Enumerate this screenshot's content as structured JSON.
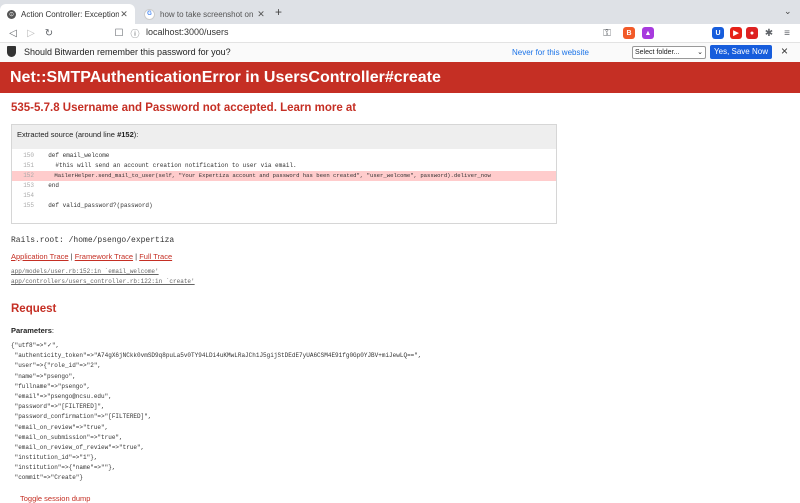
{
  "tabs": [
    {
      "title": "Action Controller: Exception ca",
      "active": true
    },
    {
      "title": "how to take screenshot on mac - G",
      "active": false
    }
  ],
  "new_tab": "+",
  "address": {
    "url": "localhost:3000/users"
  },
  "bitwarden": {
    "prompt": "Should Bitwarden remember this password for you?",
    "never_link": "Never for this website",
    "folder_select": "Select folder...",
    "save_button": "Yes, Save Now",
    "close": "×"
  },
  "error": {
    "title": "Net::SMTPAuthenticationError in UsersController#create",
    "message": "535-5.7.8 Username and Password not accepted. Learn more at"
  },
  "source": {
    "header_prefix": "Extracted source (around line ",
    "header_line": "#152",
    "header_suffix": "):",
    "lines": [
      {
        "n": "150",
        "code": "  def email_welcome"
      },
      {
        "n": "151",
        "code": "    #this will send an account creation notification to user via email."
      },
      {
        "n": "152",
        "code": "    MailerHelper.send_mail_to_user(self, \"Your Expertiza account and password has been created\", \"user_welcome\", password).deliver_now"
      },
      {
        "n": "153",
        "code": "  end"
      },
      {
        "n": "154",
        "code": ""
      },
      {
        "n": "155",
        "code": "  def valid_password?(password)"
      }
    ],
    "highlight_index": 2
  },
  "rails_root": "Rails.root: /home/psengo/expertiza",
  "traces": {
    "app": "Application Trace",
    "framework": "Framework Trace",
    "full": "Full Trace",
    "sep": "|"
  },
  "trace_lines": [
    "app/models/user.rb:152:in `email_welcome'",
    "app/controllers/users_controller.rb:122:in `create'"
  ],
  "request": {
    "heading": "Request",
    "params_label": "Parameters",
    "params_colon": ":",
    "params_lines": [
      "{\"utf8\"=>\"✓\",",
      " \"authenticity_token\"=>\"A74gX6jNCkk0vmSD9q8puLa5v0TY94LDi4uKMwLRaJCh1J5gijStDEdE7yUA6CSM4E91fg0Gp0YJBV+miJewLQ==\",",
      " \"user\"=>{\"role_id\"=>\"2\",",
      " \"name\"=>\"psengo\",",
      " \"fullname\"=>\"psengo\",",
      " \"email\"=>\"psengo@ncsu.edu\",",
      " \"password\"=>\"[FILTERED]\",",
      " \"password_confirmation\"=>\"[FILTERED]\",",
      " \"email_on_review\"=>\"true\",",
      " \"email_on_submission\"=>\"true\",",
      " \"email_on_review_of_review\"=>\"true\",",
      " \"institution_id\"=>\"1\"},",
      " \"institution\"=>{\"name\"=>\"\"},",
      " \"commit\"=>\"Create\"}"
    ],
    "toggle_session": "Toggle session dump"
  },
  "colors": {
    "error_red": "#c52f24",
    "link_blue": "#1a73e8",
    "bitwarden_blue": "#175ddc",
    "highlight": "#fcc"
  }
}
